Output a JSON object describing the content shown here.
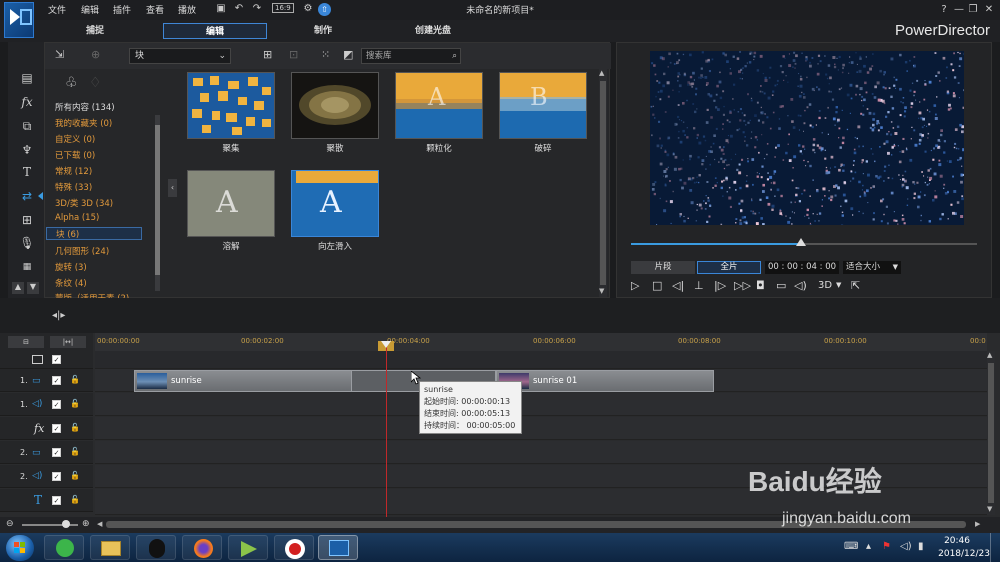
{
  "menu": [
    "文件",
    "编辑",
    "插件",
    "查看",
    "播放"
  ],
  "toolbar": {
    "resolution": "16:9"
  },
  "document_title": "未命名的新项目*",
  "window_controls": [
    "?",
    "—",
    "❐",
    "✕"
  ],
  "tabs": [
    {
      "label": "捕捉"
    },
    {
      "label": "编辑"
    },
    {
      "label": "制作"
    },
    {
      "label": "创建光盘"
    }
  ],
  "brand": "PowerDirector",
  "library": {
    "select_value": "块",
    "search_placeholder": "搜索库",
    "categories": [
      {
        "label": "所有内容 (134)"
      },
      {
        "label": "我的收藏夹 (0)"
      },
      {
        "label": "自定义 (0)"
      },
      {
        "label": "已下载 (0)"
      },
      {
        "label": "常规 (12)"
      },
      {
        "label": "特殊 (33)"
      },
      {
        "label": "3D/类 3D (34)"
      },
      {
        "label": "Alpha (15)"
      },
      {
        "label": "块 (6)"
      },
      {
        "label": "几何图形 (24)"
      },
      {
        "label": "旋转 (3)"
      },
      {
        "label": "条纹 (4)"
      },
      {
        "label": "蒙版（适用于素 (2)"
      }
    ],
    "items": [
      {
        "label": "聚集"
      },
      {
        "label": "聚散"
      },
      {
        "label": "颗粒化"
      },
      {
        "label": "破碎"
      },
      {
        "label": "溶解"
      },
      {
        "label": "向左滑入"
      }
    ],
    "thumb_letters": [
      "A",
      "B",
      "A",
      "A"
    ]
  },
  "preview": {
    "clip_button": "片段",
    "movie_button": "全片",
    "timecode": "00 : 00 : 04 : 00",
    "fit_select": "适合大小",
    "mode_3d": "3D",
    "progress": 0.49
  },
  "timeline": {
    "ruler": [
      "00:00:00:00",
      "00:00:02:00",
      "00:00:04:00",
      "00:00:06:00",
      "00:00:08:00",
      "00:00:10:00",
      "00:0"
    ],
    "tracks": [
      {
        "num": "1."
      },
      {
        "num": "1."
      },
      {
        "num": ""
      },
      {
        "num": "2."
      },
      {
        "num": "2."
      },
      {
        "num": ""
      }
    ],
    "clips": [
      {
        "label": "sunrise"
      },
      {
        "label": "sunrise 01"
      }
    ],
    "tooltip": {
      "name": "sunrise",
      "start": "起始时间: 00:00:00:13",
      "end": "结束时间: 00:00:05:13",
      "duration": "持续时间： 00:00:05:00"
    }
  },
  "taskbar": {
    "time": "20:46",
    "date": "2018/12/23"
  },
  "watermark": {
    "text": "Baidu经验",
    "url": "jingyan.baidu.com"
  }
}
